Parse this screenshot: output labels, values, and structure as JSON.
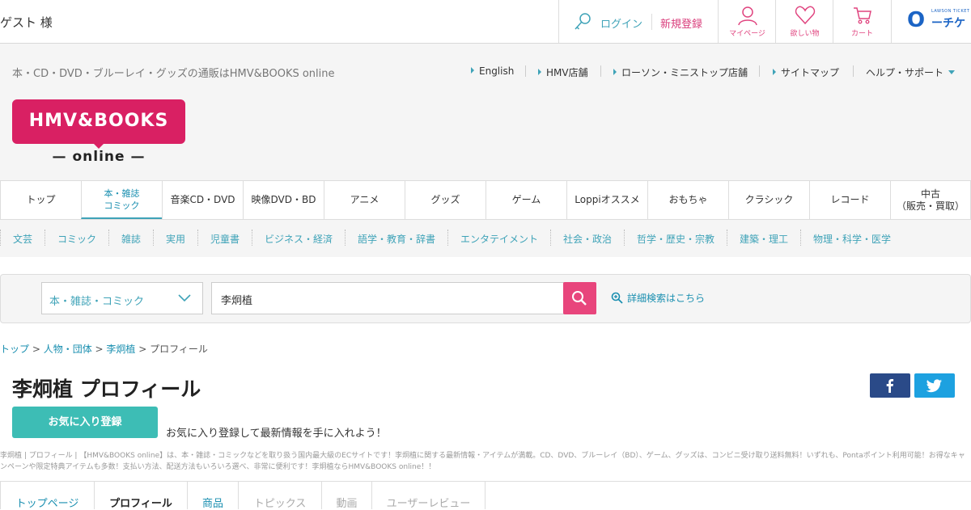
{
  "topbar": {
    "guest": "ゲスト 様",
    "login": "ログイン",
    "register": "新規登録",
    "mypage": "マイページ",
    "wishlist": "欲しい物",
    "cart": "カート",
    "ticket_tiny": "LAWSON TICKET",
    "ticket_o": "O",
    "ticket_label": "ーチケ"
  },
  "header": {
    "tagline": "本・CD・DVD・ブルーレイ・グッズの通販はHMV&BOOKS online",
    "utils": [
      "English",
      "HMV店舗",
      "ローソン・ミニストップ店舗",
      "サイトマップ"
    ],
    "help": "ヘルプ・サポート",
    "logo_main": "HMV&BOOKS",
    "logo_sub": "— online —"
  },
  "mainnav": [
    {
      "label": "トップ"
    },
    {
      "label": "本・雑誌\nコミック"
    },
    {
      "label": "音楽CD・DVD"
    },
    {
      "label": "映像DVD・BD"
    },
    {
      "label": "アニメ"
    },
    {
      "label": "グッズ"
    },
    {
      "label": "ゲーム"
    },
    {
      "label": "Loppiオススメ"
    },
    {
      "label": "おもちゃ"
    },
    {
      "label": "クラシック"
    },
    {
      "label": "レコード"
    },
    {
      "label": "中古\n（販売・買取）"
    }
  ],
  "subnav": [
    "文芸",
    "コミック",
    "雑誌",
    "実用",
    "児童書",
    "ビジネス・経済",
    "語学・教育・辞書",
    "エンタテイメント",
    "社会・政治",
    "哲学・歴史・宗教",
    "建築・理工",
    "物理・科学・医学"
  ],
  "search": {
    "category": "本・雑誌・コミック",
    "query": "李炯植",
    "advanced": "詳細検索はこちら"
  },
  "breadcrumb": {
    "top": "トップ",
    "people": "人物・団体",
    "person": "李炯植",
    "current": "プロフィール",
    "sep": " > "
  },
  "page": {
    "title": "李炯植 プロフィール",
    "fav_button": "お気に入り登録",
    "fav_note": "お気に入り登録して最新情報を手に入れよう！",
    "description": "李炯植 | プロフィール | 【HMV&BOOKS online】は、本・雑誌・コミックなどを取り扱う国内最大級のECサイトです！李炯植に関する最新情報・アイテムが満載。CD、DVD、ブルーレイ（BD）、ゲーム、グッズは、コンビニ受け取り送料無料！いずれも、Pontaポイント利用可能！お得なキャンペーンや限定特典アイテムも多数！支払い方法、配送方法もいろいろ選べ、非常に便利です！李炯植ならHMV&BOOKS online！！"
  },
  "tabs": [
    "トップページ",
    "プロフィール",
    "商品",
    "トピックス",
    "動画",
    "ユーザーレビュー"
  ],
  "colors": {
    "brand": "#d92063",
    "accent": "#3fa3b8",
    "pink": "#e8457c",
    "fav": "#3dbdb5"
  }
}
